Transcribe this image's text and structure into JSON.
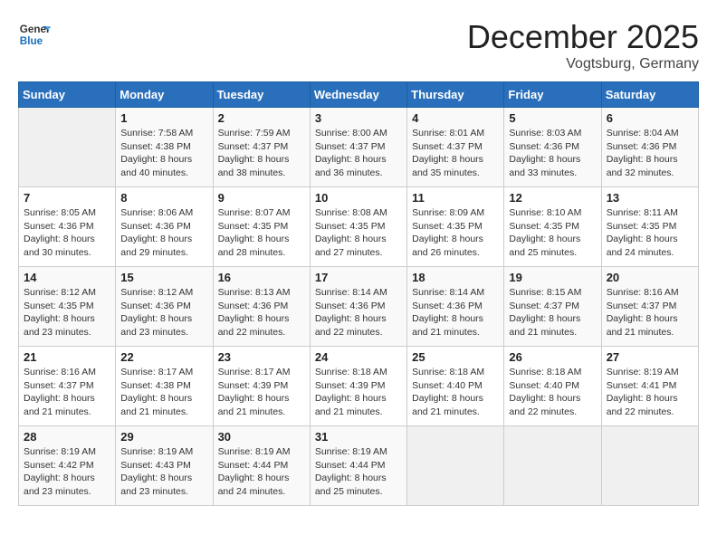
{
  "header": {
    "logo_line1": "General",
    "logo_line2": "Blue",
    "month": "December 2025",
    "location": "Vogtsburg, Germany"
  },
  "weekdays": [
    "Sunday",
    "Monday",
    "Tuesday",
    "Wednesday",
    "Thursday",
    "Friday",
    "Saturday"
  ],
  "weeks": [
    [
      {
        "day": "",
        "info": ""
      },
      {
        "day": "1",
        "info": "Sunrise: 7:58 AM\nSunset: 4:38 PM\nDaylight: 8 hours\nand 40 minutes."
      },
      {
        "day": "2",
        "info": "Sunrise: 7:59 AM\nSunset: 4:37 PM\nDaylight: 8 hours\nand 38 minutes."
      },
      {
        "day": "3",
        "info": "Sunrise: 8:00 AM\nSunset: 4:37 PM\nDaylight: 8 hours\nand 36 minutes."
      },
      {
        "day": "4",
        "info": "Sunrise: 8:01 AM\nSunset: 4:37 PM\nDaylight: 8 hours\nand 35 minutes."
      },
      {
        "day": "5",
        "info": "Sunrise: 8:03 AM\nSunset: 4:36 PM\nDaylight: 8 hours\nand 33 minutes."
      },
      {
        "day": "6",
        "info": "Sunrise: 8:04 AM\nSunset: 4:36 PM\nDaylight: 8 hours\nand 32 minutes."
      }
    ],
    [
      {
        "day": "7",
        "info": "Sunrise: 8:05 AM\nSunset: 4:36 PM\nDaylight: 8 hours\nand 30 minutes."
      },
      {
        "day": "8",
        "info": "Sunrise: 8:06 AM\nSunset: 4:36 PM\nDaylight: 8 hours\nand 29 minutes."
      },
      {
        "day": "9",
        "info": "Sunrise: 8:07 AM\nSunset: 4:35 PM\nDaylight: 8 hours\nand 28 minutes."
      },
      {
        "day": "10",
        "info": "Sunrise: 8:08 AM\nSunset: 4:35 PM\nDaylight: 8 hours\nand 27 minutes."
      },
      {
        "day": "11",
        "info": "Sunrise: 8:09 AM\nSunset: 4:35 PM\nDaylight: 8 hours\nand 26 minutes."
      },
      {
        "day": "12",
        "info": "Sunrise: 8:10 AM\nSunset: 4:35 PM\nDaylight: 8 hours\nand 25 minutes."
      },
      {
        "day": "13",
        "info": "Sunrise: 8:11 AM\nSunset: 4:35 PM\nDaylight: 8 hours\nand 24 minutes."
      }
    ],
    [
      {
        "day": "14",
        "info": "Sunrise: 8:12 AM\nSunset: 4:35 PM\nDaylight: 8 hours\nand 23 minutes."
      },
      {
        "day": "15",
        "info": "Sunrise: 8:12 AM\nSunset: 4:36 PM\nDaylight: 8 hours\nand 23 minutes."
      },
      {
        "day": "16",
        "info": "Sunrise: 8:13 AM\nSunset: 4:36 PM\nDaylight: 8 hours\nand 22 minutes."
      },
      {
        "day": "17",
        "info": "Sunrise: 8:14 AM\nSunset: 4:36 PM\nDaylight: 8 hours\nand 22 minutes."
      },
      {
        "day": "18",
        "info": "Sunrise: 8:14 AM\nSunset: 4:36 PM\nDaylight: 8 hours\nand 21 minutes."
      },
      {
        "day": "19",
        "info": "Sunrise: 8:15 AM\nSunset: 4:37 PM\nDaylight: 8 hours\nand 21 minutes."
      },
      {
        "day": "20",
        "info": "Sunrise: 8:16 AM\nSunset: 4:37 PM\nDaylight: 8 hours\nand 21 minutes."
      }
    ],
    [
      {
        "day": "21",
        "info": "Sunrise: 8:16 AM\nSunset: 4:37 PM\nDaylight: 8 hours\nand 21 minutes."
      },
      {
        "day": "22",
        "info": "Sunrise: 8:17 AM\nSunset: 4:38 PM\nDaylight: 8 hours\nand 21 minutes."
      },
      {
        "day": "23",
        "info": "Sunrise: 8:17 AM\nSunset: 4:39 PM\nDaylight: 8 hours\nand 21 minutes."
      },
      {
        "day": "24",
        "info": "Sunrise: 8:18 AM\nSunset: 4:39 PM\nDaylight: 8 hours\nand 21 minutes."
      },
      {
        "day": "25",
        "info": "Sunrise: 8:18 AM\nSunset: 4:40 PM\nDaylight: 8 hours\nand 21 minutes."
      },
      {
        "day": "26",
        "info": "Sunrise: 8:18 AM\nSunset: 4:40 PM\nDaylight: 8 hours\nand 22 minutes."
      },
      {
        "day": "27",
        "info": "Sunrise: 8:19 AM\nSunset: 4:41 PM\nDaylight: 8 hours\nand 22 minutes."
      }
    ],
    [
      {
        "day": "28",
        "info": "Sunrise: 8:19 AM\nSunset: 4:42 PM\nDaylight: 8 hours\nand 23 minutes."
      },
      {
        "day": "29",
        "info": "Sunrise: 8:19 AM\nSunset: 4:43 PM\nDaylight: 8 hours\nand 23 minutes."
      },
      {
        "day": "30",
        "info": "Sunrise: 8:19 AM\nSunset: 4:44 PM\nDaylight: 8 hours\nand 24 minutes."
      },
      {
        "day": "31",
        "info": "Sunrise: 8:19 AM\nSunset: 4:44 PM\nDaylight: 8 hours\nand 25 minutes."
      },
      {
        "day": "",
        "info": ""
      },
      {
        "day": "",
        "info": ""
      },
      {
        "day": "",
        "info": ""
      }
    ]
  ]
}
